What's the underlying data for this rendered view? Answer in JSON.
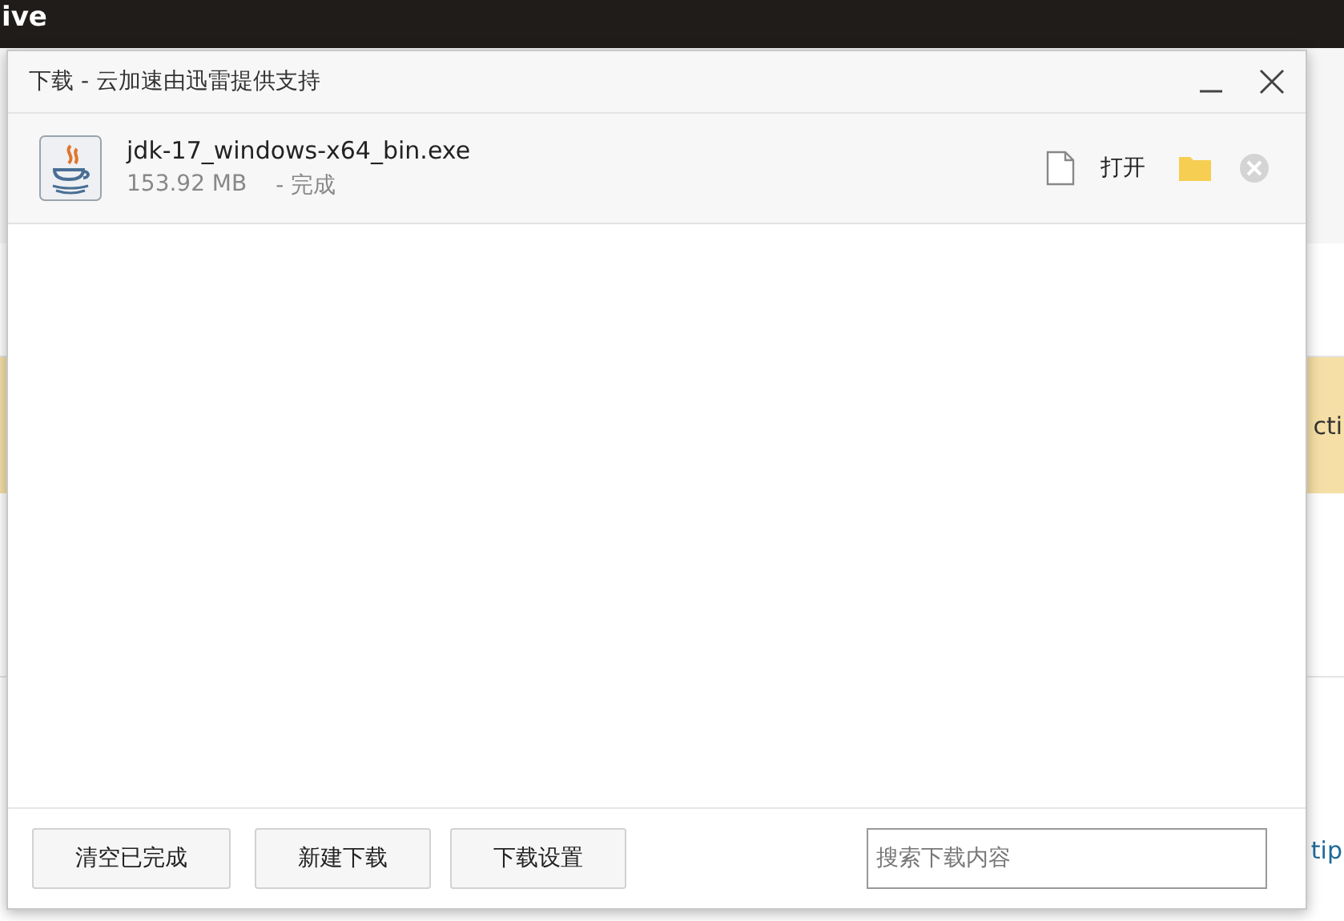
{
  "background": {
    "header_text": "ive",
    "banner_text": "cti",
    "right_text": "tip"
  },
  "window": {
    "title": "下载 - 云加速由迅雷提供支持"
  },
  "downloads": [
    {
      "filename": "jdk-17_windows-x64_bin.exe",
      "size": "153.92 MB",
      "status": "- 完成",
      "open_label": "打开"
    }
  ],
  "buttons": [
    "清空已完成",
    "新建下载",
    "下载设置"
  ],
  "search": {
    "placeholder": "搜索下载内容"
  }
}
